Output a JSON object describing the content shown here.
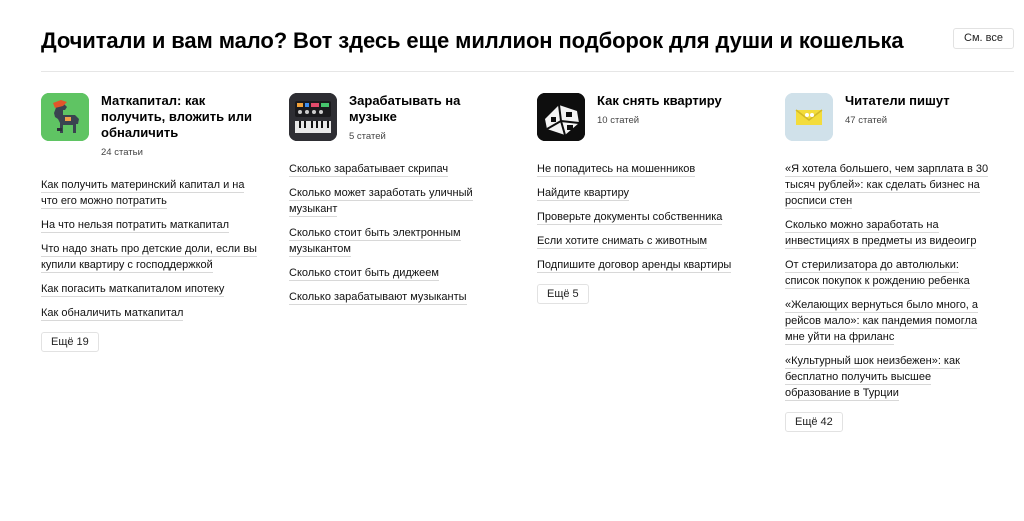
{
  "header": {
    "title": "Дочитали и вам мало? Вот здесь еще миллион подборок для души и кошелька",
    "see_all": "См. все"
  },
  "columns": [
    {
      "title": "Маткапитал: как получить, вложить или обналичить",
      "count": "24 статьи",
      "icon": "horse-icon",
      "links": [
        "Как получить материнский капитал и на что его можно потратить",
        "На что нельзя потратить маткапитал",
        "Что надо знать про детские доли, если вы купили квартиру с господдержкой",
        "Как погасить маткапиталом ипотеку",
        "Как обналичить маткапитал"
      ],
      "more": "Ещё 19"
    },
    {
      "title": "Зарабатывать на музыке",
      "count": "5 статей",
      "icon": "synthesizer-icon",
      "links": [
        "Сколько зарабатывает скрипач",
        "Сколько может заработать уличный музыкант",
        "Сколько стоит быть электронным музыкантом",
        "Сколько стоит быть диджеем",
        "Сколько зарабатывают музыканты"
      ],
      "more": ""
    },
    {
      "title": "Как снять квартиру",
      "count": "10 статей",
      "icon": "house-icon",
      "links": [
        "Не попадитесь на мошенников",
        "Найдите квартиру",
        "Проверьте документы собственника",
        "Если хотите снимать с животным",
        "Подпишите договор аренды квартиры"
      ],
      "more": "Ещё 5"
    },
    {
      "title": "Читатели пишут",
      "count": "47 статей",
      "icon": "envelope-icon",
      "links": [
        "«Я хотела большего, чем зарплата в 30 тысяч рублей»: как сделать бизнес на росписи стен",
        "Сколько можно заработать на инвестициях в предметы из видеоигр",
        "От стерилизатора до автолюльки: список покупок к рождению ребенка",
        "«Желающих вернуться было много, а рейсов мало»: как пандемия помогла мне уйти на фриланс",
        "«Культурный шок неизбежен»: как бесплатно получить высшее образование в Турции"
      ],
      "more": "Ещё 42"
    }
  ]
}
